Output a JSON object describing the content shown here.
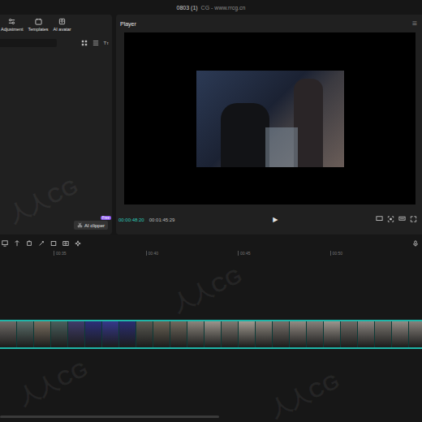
{
  "window": {
    "title": "0803 (1)",
    "watermark": "CG - www.rrcg.cn",
    "overlay_mark": "人人CG"
  },
  "toolbar": {
    "tabs": [
      {
        "label": "Adjustment"
      },
      {
        "label": "Templates"
      },
      {
        "label": "AI avatar"
      }
    ]
  },
  "media": {
    "text_button": "Tт",
    "ai_clipper": {
      "label": "AI clipper",
      "badge": "Free"
    }
  },
  "player": {
    "title": "Player",
    "menu": "☰",
    "current_time": "00:00:48:20",
    "total_time": "00:01:45:29",
    "play": "▶"
  },
  "timeline": {
    "ruler": [
      "00:35",
      "00:40",
      "00:45",
      "00:50"
    ],
    "clip": {
      "selected": true
    }
  }
}
